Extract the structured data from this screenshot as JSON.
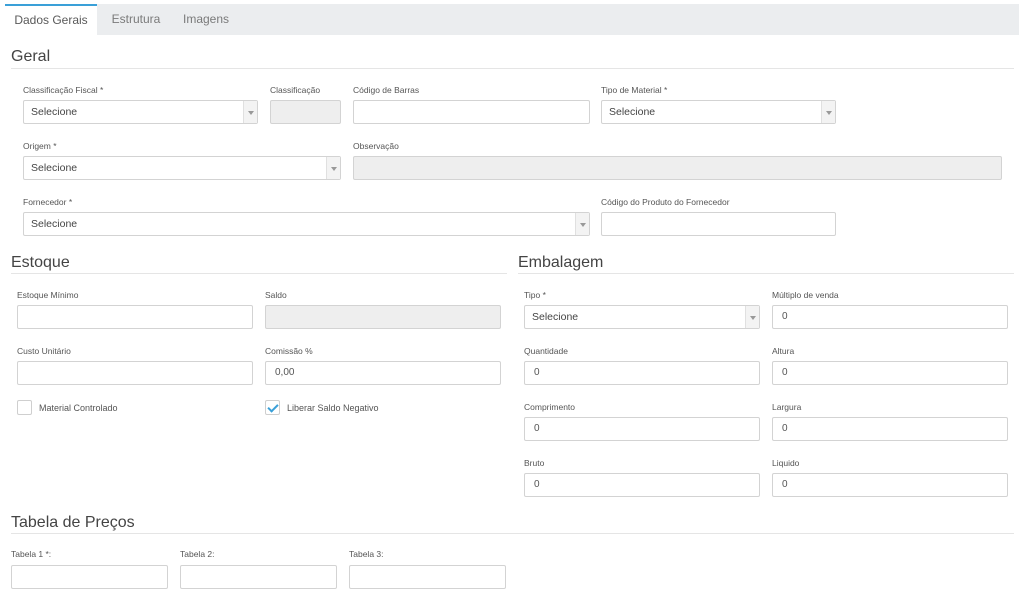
{
  "tabs": [
    {
      "label": "Dados Gerais",
      "active": true
    },
    {
      "label": "Estrutura",
      "active": false
    },
    {
      "label": "Imagens",
      "active": false
    }
  ],
  "accent_color": "#3aa0d8",
  "geral": {
    "title": "Geral",
    "classificacao_fiscal": {
      "label": "Classificação Fiscal *",
      "value": "Selecione"
    },
    "classificacao": {
      "label": "Classificação",
      "value": ""
    },
    "codigo_barras": {
      "label": "Código de Barras",
      "value": ""
    },
    "tipo_material": {
      "label": "Tipo de Material *",
      "value": "Selecione"
    },
    "origem": {
      "label": "Origem *",
      "value": "Selecione"
    },
    "observacao": {
      "label": "Observação",
      "value": ""
    },
    "fornecedor": {
      "label": "Fornecedor *",
      "value": "Selecione"
    },
    "codigo_produto_fornecedor": {
      "label": "Código do Produto do Fornecedor",
      "value": ""
    }
  },
  "estoque": {
    "title": "Estoque",
    "estoque_minimo": {
      "label": "Estoque Mínimo",
      "value": ""
    },
    "saldo": {
      "label": "Saldo",
      "value": ""
    },
    "custo_unitario": {
      "label": "Custo Unitário",
      "value": ""
    },
    "comissao": {
      "label": "Comissão %",
      "value": "0,00"
    },
    "material_controlado": {
      "label": "Material Controlado",
      "checked": false
    },
    "liberar_saldo_negativo": {
      "label": "Liberar Saldo Negativo",
      "checked": true
    }
  },
  "embalagem": {
    "title": "Embalagem",
    "tipo": {
      "label": "Tipo *",
      "value": "Selecione"
    },
    "multiplo_venda": {
      "label": "Múltiplo de venda",
      "value": "0"
    },
    "quantidade": {
      "label": "Quantidade",
      "value": "0"
    },
    "altura": {
      "label": "Altura",
      "value": "0"
    },
    "comprimento": {
      "label": "Comprimento",
      "value": "0"
    },
    "largura": {
      "label": "Largura",
      "value": "0"
    },
    "bruto": {
      "label": "Bruto",
      "value": "0"
    },
    "liquido": {
      "label": "Liquido",
      "value": "0"
    }
  },
  "precos": {
    "title": "Tabela de Preços",
    "tabela1": {
      "label": "Tabela 1 *:",
      "value": ""
    },
    "tabela2": {
      "label": "Tabela 2:",
      "value": ""
    },
    "tabela3": {
      "label": "Tabela 3:",
      "value": ""
    }
  }
}
